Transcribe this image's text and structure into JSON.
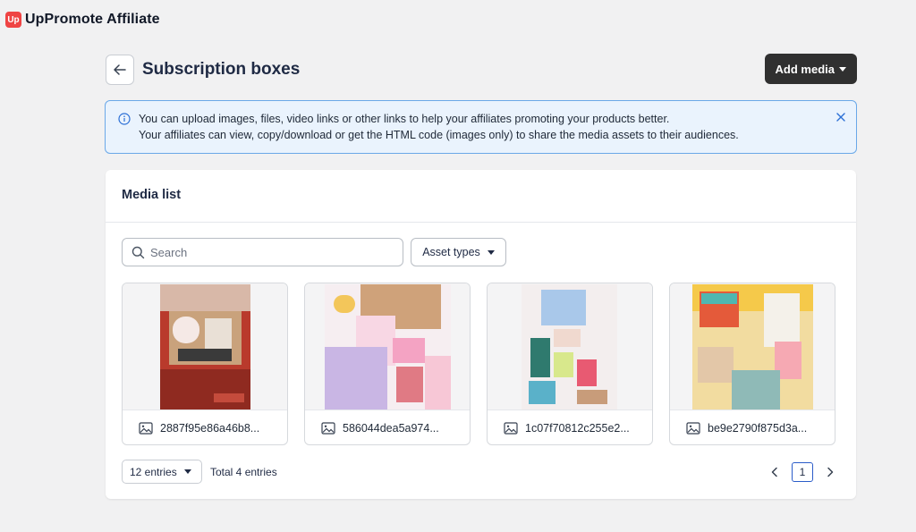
{
  "app": {
    "title": "UpPromote Affiliate",
    "logo_text": "Up"
  },
  "header": {
    "title": "Subscription boxes",
    "add_media_label": "Add media"
  },
  "banner": {
    "line1": "You can upload images, files, video links or other links to help your affiliates promoting your products better.",
    "line2": "Your affiliates can view, copy/download or get the HTML code (images only) to share the media assets to their audiences."
  },
  "media_list": {
    "title": "Media list",
    "search_placeholder": "Search",
    "asset_types_label": "Asset types",
    "items": [
      {
        "name": "2887f95e86a46b8...",
        "icon": "image-icon"
      },
      {
        "name": "586044dea5a974...",
        "icon": "image-icon"
      },
      {
        "name": "1c07f70812c255e2...",
        "icon": "image-icon"
      },
      {
        "name": "be9e2790f875d3a...",
        "icon": "image-icon"
      }
    ]
  },
  "pagination": {
    "entries_label": "12 entries",
    "total_label": "Total 4 entries",
    "current_page": "1"
  },
  "colors": {
    "brand": "#ef4444",
    "primary_button": "#303030",
    "banner_bg": "#eaf3fd",
    "banner_border": "#6aa8e8",
    "page_active_border": "#2b5cc9"
  }
}
